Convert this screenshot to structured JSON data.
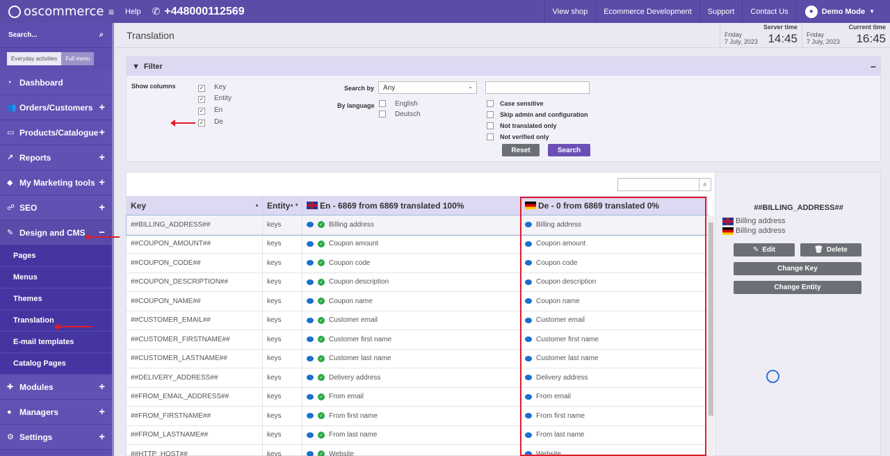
{
  "topbar": {
    "logo_text": "oscommerce",
    "help": "Help",
    "phone": "+448000112569",
    "links": [
      "View shop",
      "Ecommerce Development",
      "Support",
      "Contact Us"
    ],
    "user": "Demo Mode"
  },
  "sidebar": {
    "search": "Search...",
    "tabs": [
      "Everyday activities",
      "Full menu"
    ],
    "items": [
      {
        "label": "Dashboard",
        "icon": "dashboard-icon"
      },
      {
        "label": "Orders/Customers",
        "icon": "users-icon"
      },
      {
        "label": "Products/Catalogue",
        "icon": "folder-icon"
      },
      {
        "label": "Reports",
        "icon": "chart-icon"
      },
      {
        "label": "My Marketing tools",
        "icon": "tag-icon"
      },
      {
        "label": "SEO",
        "icon": "sitemap-icon"
      },
      {
        "label": "Design and CMS",
        "icon": "brush-icon"
      }
    ],
    "sub_items": [
      "Pages",
      "Menus",
      "Themes",
      "Translation",
      "E-mail templates",
      "Catalog Pages"
    ],
    "bottom_items": [
      {
        "label": "Modules",
        "icon": "puzzle-icon"
      },
      {
        "label": "Managers",
        "icon": "user-icon"
      },
      {
        "label": "Settings",
        "icon": "cogs-icon"
      }
    ]
  },
  "page": {
    "title": "Translation",
    "server_time": {
      "label": "Server time",
      "day": "Friday",
      "date": "7 July, 2023",
      "time": "14:45"
    },
    "current_time": {
      "label": "Current time",
      "day": "Friday",
      "date": "7 July, 2023",
      "time": "16:45"
    }
  },
  "filter": {
    "title": "Filter",
    "show_columns_label": "Show columns",
    "columns": [
      "Key",
      "Entity",
      "En",
      "De"
    ],
    "search_by_label": "Search by",
    "search_by_value": "Any",
    "by_language_label": "By language",
    "languages": [
      "English",
      "Deutsch"
    ],
    "options": [
      "Case sensitive",
      "Skip admin and configuration",
      "Not translated only",
      "Not verified only"
    ],
    "reset": "Reset",
    "search": "Search"
  },
  "table": {
    "headers": {
      "key": "Key",
      "entity": "Entity",
      "en": "En - 6869 from 6869 translated 100%",
      "de": "De - 0 from 6869 translated 0%"
    },
    "rows": [
      {
        "key": "##BILLING_ADDRESS##",
        "entity": "keys",
        "en": "Billing address",
        "de": "Billing address"
      },
      {
        "key": "##COUPON_AMOUNT##",
        "entity": "keys",
        "en": "Coupon amount",
        "de": "Coupon amount"
      },
      {
        "key": "##COUPON_CODE##",
        "entity": "keys",
        "en": "Coupon code",
        "de": "Coupon code"
      },
      {
        "key": "##COUPON_DESCRIPTION##",
        "entity": "keys",
        "en": "Coupon description",
        "de": "Coupon description"
      },
      {
        "key": "##COUPON_NAME##",
        "entity": "keys",
        "en": "Coupon name",
        "de": "Coupon name"
      },
      {
        "key": "##CUSTOMER_EMAIL##",
        "entity": "keys",
        "en": "Customer email",
        "de": "Customer email"
      },
      {
        "key": "##CUSTOMER_FIRSTNAME##",
        "entity": "keys",
        "en": "Customer first name",
        "de": "Customer first name"
      },
      {
        "key": "##CUSTOMER_LASTNAME##",
        "entity": "keys",
        "en": "Customer last name",
        "de": "Customer last name"
      },
      {
        "key": "##DELIVERY_ADDRESS##",
        "entity": "keys",
        "en": "Delivery address",
        "de": "Delivery address"
      },
      {
        "key": "##FROM_EMAIL_ADDRESS##",
        "entity": "keys",
        "en": "From email",
        "de": "From email"
      },
      {
        "key": "##FROM_FIRSTNAME##",
        "entity": "keys",
        "en": "From first name",
        "de": "From first name"
      },
      {
        "key": "##FROM_LASTNAME##",
        "entity": "keys",
        "en": "From last name",
        "de": "From last name"
      },
      {
        "key": "##HTTP_HOST##",
        "entity": "keys",
        "en": "Website",
        "de": "Website"
      }
    ]
  },
  "detail": {
    "title": "##BILLING_ADDRESS##",
    "en_value": "Billing address",
    "de_value": "Billing address",
    "edit": "Edit",
    "delete": "Delete",
    "change_key": "Change Key",
    "change_entity": "Change Entity"
  },
  "colors": {
    "brand": "#5a4da8",
    "highlight": "#e01b2a"
  }
}
